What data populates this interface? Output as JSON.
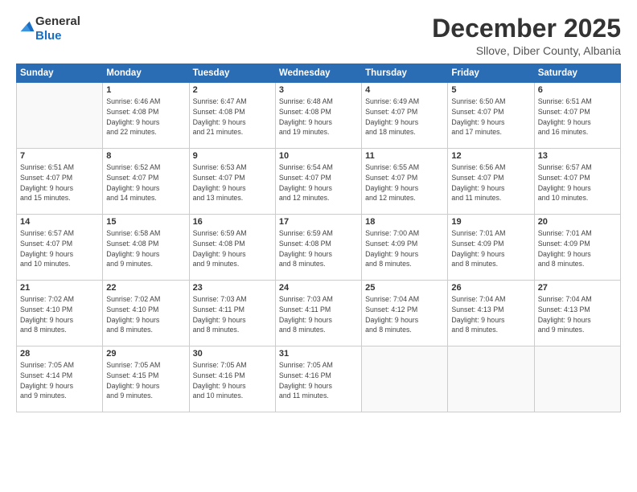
{
  "logo": {
    "general": "General",
    "blue": "Blue"
  },
  "header": {
    "month": "December 2025",
    "location": "Sllove, Diber County, Albania"
  },
  "days_of_week": [
    "Sunday",
    "Monday",
    "Tuesday",
    "Wednesday",
    "Thursday",
    "Friday",
    "Saturday"
  ],
  "weeks": [
    [
      {
        "day": "",
        "info": ""
      },
      {
        "day": "1",
        "info": "Sunrise: 6:46 AM\nSunset: 4:08 PM\nDaylight: 9 hours\nand 22 minutes."
      },
      {
        "day": "2",
        "info": "Sunrise: 6:47 AM\nSunset: 4:08 PM\nDaylight: 9 hours\nand 21 minutes."
      },
      {
        "day": "3",
        "info": "Sunrise: 6:48 AM\nSunset: 4:08 PM\nDaylight: 9 hours\nand 19 minutes."
      },
      {
        "day": "4",
        "info": "Sunrise: 6:49 AM\nSunset: 4:07 PM\nDaylight: 9 hours\nand 18 minutes."
      },
      {
        "day": "5",
        "info": "Sunrise: 6:50 AM\nSunset: 4:07 PM\nDaylight: 9 hours\nand 17 minutes."
      },
      {
        "day": "6",
        "info": "Sunrise: 6:51 AM\nSunset: 4:07 PM\nDaylight: 9 hours\nand 16 minutes."
      }
    ],
    [
      {
        "day": "7",
        "info": "Sunrise: 6:51 AM\nSunset: 4:07 PM\nDaylight: 9 hours\nand 15 minutes."
      },
      {
        "day": "8",
        "info": "Sunrise: 6:52 AM\nSunset: 4:07 PM\nDaylight: 9 hours\nand 14 minutes."
      },
      {
        "day": "9",
        "info": "Sunrise: 6:53 AM\nSunset: 4:07 PM\nDaylight: 9 hours\nand 13 minutes."
      },
      {
        "day": "10",
        "info": "Sunrise: 6:54 AM\nSunset: 4:07 PM\nDaylight: 9 hours\nand 12 minutes."
      },
      {
        "day": "11",
        "info": "Sunrise: 6:55 AM\nSunset: 4:07 PM\nDaylight: 9 hours\nand 12 minutes."
      },
      {
        "day": "12",
        "info": "Sunrise: 6:56 AM\nSunset: 4:07 PM\nDaylight: 9 hours\nand 11 minutes."
      },
      {
        "day": "13",
        "info": "Sunrise: 6:57 AM\nSunset: 4:07 PM\nDaylight: 9 hours\nand 10 minutes."
      }
    ],
    [
      {
        "day": "14",
        "info": "Sunrise: 6:57 AM\nSunset: 4:07 PM\nDaylight: 9 hours\nand 10 minutes."
      },
      {
        "day": "15",
        "info": "Sunrise: 6:58 AM\nSunset: 4:08 PM\nDaylight: 9 hours\nand 9 minutes."
      },
      {
        "day": "16",
        "info": "Sunrise: 6:59 AM\nSunset: 4:08 PM\nDaylight: 9 hours\nand 9 minutes."
      },
      {
        "day": "17",
        "info": "Sunrise: 6:59 AM\nSunset: 4:08 PM\nDaylight: 9 hours\nand 8 minutes."
      },
      {
        "day": "18",
        "info": "Sunrise: 7:00 AM\nSunset: 4:09 PM\nDaylight: 9 hours\nand 8 minutes."
      },
      {
        "day": "19",
        "info": "Sunrise: 7:01 AM\nSunset: 4:09 PM\nDaylight: 9 hours\nand 8 minutes."
      },
      {
        "day": "20",
        "info": "Sunrise: 7:01 AM\nSunset: 4:09 PM\nDaylight: 9 hours\nand 8 minutes."
      }
    ],
    [
      {
        "day": "21",
        "info": "Sunrise: 7:02 AM\nSunset: 4:10 PM\nDaylight: 9 hours\nand 8 minutes."
      },
      {
        "day": "22",
        "info": "Sunrise: 7:02 AM\nSunset: 4:10 PM\nDaylight: 9 hours\nand 8 minutes."
      },
      {
        "day": "23",
        "info": "Sunrise: 7:03 AM\nSunset: 4:11 PM\nDaylight: 9 hours\nand 8 minutes."
      },
      {
        "day": "24",
        "info": "Sunrise: 7:03 AM\nSunset: 4:11 PM\nDaylight: 9 hours\nand 8 minutes."
      },
      {
        "day": "25",
        "info": "Sunrise: 7:04 AM\nSunset: 4:12 PM\nDaylight: 9 hours\nand 8 minutes."
      },
      {
        "day": "26",
        "info": "Sunrise: 7:04 AM\nSunset: 4:13 PM\nDaylight: 9 hours\nand 8 minutes."
      },
      {
        "day": "27",
        "info": "Sunrise: 7:04 AM\nSunset: 4:13 PM\nDaylight: 9 hours\nand 9 minutes."
      }
    ],
    [
      {
        "day": "28",
        "info": "Sunrise: 7:05 AM\nSunset: 4:14 PM\nDaylight: 9 hours\nand 9 minutes."
      },
      {
        "day": "29",
        "info": "Sunrise: 7:05 AM\nSunset: 4:15 PM\nDaylight: 9 hours\nand 9 minutes."
      },
      {
        "day": "30",
        "info": "Sunrise: 7:05 AM\nSunset: 4:16 PM\nDaylight: 9 hours\nand 10 minutes."
      },
      {
        "day": "31",
        "info": "Sunrise: 7:05 AM\nSunset: 4:16 PM\nDaylight: 9 hours\nand 11 minutes."
      },
      {
        "day": "",
        "info": ""
      },
      {
        "day": "",
        "info": ""
      },
      {
        "day": "",
        "info": ""
      }
    ]
  ]
}
